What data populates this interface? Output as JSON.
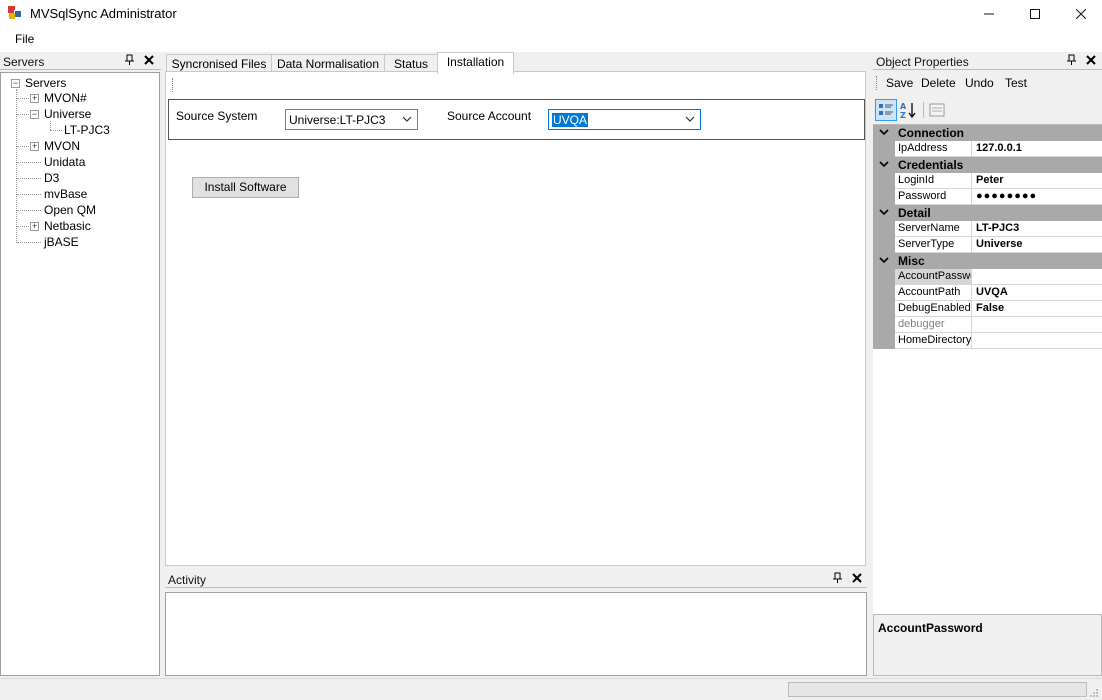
{
  "window": {
    "title": "MVSqlSync Administrator"
  },
  "menu": {
    "file": "File"
  },
  "servers_pane": {
    "title": "Servers",
    "pin": "ᴨ",
    "close": "✕",
    "tree": {
      "root": "Servers",
      "nodes": [
        {
          "label": "MVON#",
          "expander": "+"
        },
        {
          "label": "Universe",
          "expander": "−"
        },
        {
          "label": "LT-PJC3"
        },
        {
          "label": "MVON",
          "expander": "+"
        },
        {
          "label": "Unidata"
        },
        {
          "label": "D3"
        },
        {
          "label": "mvBase"
        },
        {
          "label": "Open QM"
        },
        {
          "label": "Netbasic",
          "expander": "+"
        },
        {
          "label": "jBASE"
        }
      ]
    }
  },
  "tabs": [
    {
      "label": "Syncronised Files"
    },
    {
      "label": "Data Normalisation"
    },
    {
      "label": "Status"
    },
    {
      "label": "Installation"
    }
  ],
  "installation": {
    "source_system_label": "Source System",
    "source_system_value": "Universe:LT-PJC3",
    "source_account_label": "Source Account",
    "source_account_value": "UVQA",
    "install_button": "Install Software"
  },
  "activity_pane": {
    "title": "Activity",
    "pin": "ᴨ",
    "close": "✕"
  },
  "properties_pane": {
    "title": "Object Properties",
    "pin": "ᴨ",
    "close": "✕",
    "toolbar": {
      "save": "Save",
      "delete": "Delete",
      "undo": "Undo",
      "test": "Test"
    },
    "categories": [
      {
        "name": "Connection",
        "rows": [
          {
            "name": "IpAddress",
            "value": "127.0.0.1"
          }
        ]
      },
      {
        "name": "Credentials",
        "rows": [
          {
            "name": "LoginId",
            "value": "Peter"
          },
          {
            "name": "Password",
            "value": "●●●●●●●●"
          }
        ]
      },
      {
        "name": "Detail",
        "rows": [
          {
            "name": "ServerName",
            "value": "LT-PJC3"
          },
          {
            "name": "ServerType",
            "value": "Universe"
          }
        ]
      },
      {
        "name": "Misc",
        "rows": [
          {
            "name": "AccountPassword",
            "value": ""
          },
          {
            "name": "AccountPath",
            "value": "UVQA"
          },
          {
            "name": "DebugEnabled",
            "value": "False"
          },
          {
            "name": "debugger",
            "value": ""
          },
          {
            "name": "HomeDirectory",
            "value": ""
          }
        ]
      }
    ],
    "description_title": "AccountPassword"
  }
}
